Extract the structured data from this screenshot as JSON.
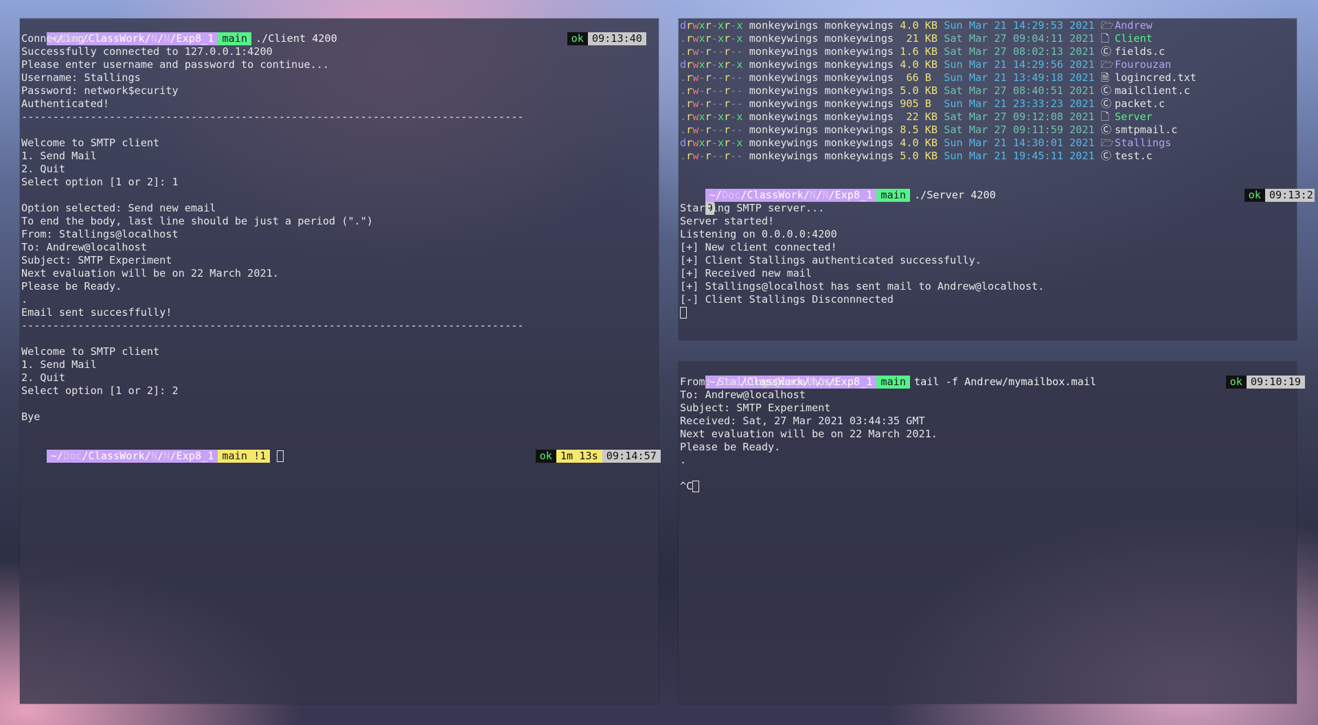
{
  "left_terminal": {
    "prompt1": {
      "path_home": "~/",
      "path_dim1": "Doc",
      "path_mid": "/ClassWork/",
      "path_dim2": "N",
      "path_sep": "/",
      "path_dim3": "N",
      "path_tail": "/Exp8_1",
      "branch": "main",
      "command": "./Client 4200",
      "status": "ok",
      "time": "09:13:40"
    },
    "output": [
      "Connecting...",
      "Successfully connected to 127.0.0.1:4200",
      "Please enter username and password to continue...",
      "Username: Stallings",
      "Password: network$ecurity",
      "Authenticated!",
      "--------------------------------------------------------------------------------",
      "",
      "Welcome to SMTP client",
      "1. Send Mail",
      "2. Quit",
      "Select option [1 or 2]: 1",
      "",
      "Option selected: Send new email",
      "To end the body, last line should be just a period (\".\")",
      "From: Stallings@localhost",
      "To: Andrew@localhost",
      "Subject: SMTP Experiment",
      "Next evaluation will be on 22 March 2021.",
      "Please be Ready.",
      ".",
      "Email sent succesffully!",
      "--------------------------------------------------------------------------------",
      "",
      "Welcome to SMTP client",
      "1. Send Mail",
      "2. Quit",
      "Select option [1 or 2]: 2",
      "",
      "Bye"
    ],
    "prompt2": {
      "path_home": "~/",
      "path_dim1": "Doc",
      "path_mid": "/ClassWork/",
      "path_dim2": "N",
      "path_sep": "/",
      "path_dim3": "N",
      "path_tail": "/Exp8_1",
      "branch": "main !1",
      "status": "ok",
      "duration": "1m 13s",
      "time": "09:14:57"
    }
  },
  "ls_listing": [
    {
      "type": "d",
      "perm": [
        "d",
        "r",
        "w",
        "x",
        "r",
        "-",
        "x",
        "r",
        "-",
        "x"
      ],
      "owner": "monkeywings",
      "group": "monkeywings",
      "size": "4.0 KB",
      "date": "Sun Mar 21 14:29:53 2021",
      "icon": "folder-icon",
      "name": "Andrew",
      "kind": "dir"
    },
    {
      "type": ".",
      "perm": [
        ".",
        "r",
        "w",
        "x",
        "r",
        "-",
        "x",
        "r",
        "-",
        "x"
      ],
      "owner": "monkeywings",
      "group": "monkeywings",
      "size": " 21 KB",
      "date": "Sat Mar 27 09:04:11 2021",
      "icon": "file-icon",
      "name": "Client",
      "kind": "exe"
    },
    {
      "type": ".",
      "perm": [
        ".",
        "r",
        "w",
        "-",
        "r",
        "-",
        "-",
        "r",
        "-",
        "-"
      ],
      "owner": "monkeywings",
      "group": "monkeywings",
      "size": "1.6 KB",
      "date": "Sat Mar 27 08:02:13 2021",
      "icon": "c-icon",
      "name": "fields.c",
      "kind": "c"
    },
    {
      "type": "d",
      "perm": [
        "d",
        "r",
        "w",
        "x",
        "r",
        "-",
        "x",
        "r",
        "-",
        "x"
      ],
      "owner": "monkeywings",
      "group": "monkeywings",
      "size": "4.0 KB",
      "date": "Sun Mar 21 14:29:56 2021",
      "icon": "folder-icon",
      "name": "Fourouzan",
      "kind": "dir"
    },
    {
      "type": ".",
      "perm": [
        ".",
        "r",
        "w",
        "-",
        "r",
        "-",
        "-",
        "r",
        "-",
        "-"
      ],
      "owner": "monkeywings",
      "group": "monkeywings",
      "size": " 66 B ",
      "date": "Sun Mar 21 13:49:18 2021",
      "icon": "doc-icon",
      "name": "logincred.txt",
      "kind": "c"
    },
    {
      "type": ".",
      "perm": [
        ".",
        "r",
        "w",
        "-",
        "r",
        "-",
        "-",
        "r",
        "-",
        "-"
      ],
      "owner": "monkeywings",
      "group": "monkeywings",
      "size": "5.0 KB",
      "date": "Sat Mar 27 08:40:51 2021",
      "icon": "c-icon",
      "name": "mailclient.c",
      "kind": "c"
    },
    {
      "type": ".",
      "perm": [
        ".",
        "r",
        "w",
        "-",
        "r",
        "-",
        "-",
        "r",
        "-",
        "-"
      ],
      "owner": "monkeywings",
      "group": "monkeywings",
      "size": "905 B ",
      "date": "Sun Mar 21 23:33:23 2021",
      "icon": "c-icon",
      "name": "packet.c",
      "kind": "c"
    },
    {
      "type": ".",
      "perm": [
        ".",
        "r",
        "w",
        "x",
        "r",
        "-",
        "x",
        "r",
        "-",
        "x"
      ],
      "owner": "monkeywings",
      "group": "monkeywings",
      "size": " 22 KB",
      "date": "Sat Mar 27 09:12:08 2021",
      "icon": "file-icon",
      "name": "Server",
      "kind": "exe"
    },
    {
      "type": ".",
      "perm": [
        ".",
        "r",
        "w",
        "-",
        "r",
        "-",
        "-",
        "r",
        "-",
        "-"
      ],
      "owner": "monkeywings",
      "group": "monkeywings",
      "size": "8.5 KB",
      "date": "Sat Mar 27 09:11:59 2021",
      "icon": "c-icon",
      "name": "smtpmail.c",
      "kind": "c"
    },
    {
      "type": "d",
      "perm": [
        "d",
        "r",
        "w",
        "x",
        "r",
        "-",
        "x",
        "r",
        "-",
        "x"
      ],
      "owner": "monkeywings",
      "group": "monkeywings",
      "size": "4.0 KB",
      "date": "Sun Mar 21 14:30:01 2021",
      "icon": "folder-icon",
      "name": "Stallings",
      "kind": "dir"
    },
    {
      "type": ".",
      "perm": [
        ".",
        "r",
        "w",
        "-",
        "r",
        "-",
        "-",
        "r",
        "-",
        "-"
      ],
      "owner": "monkeywings",
      "group": "monkeywings",
      "size": "5.0 KB",
      "date": "Sun Mar 21 19:45:11 2021",
      "icon": "c-icon",
      "name": "test.c",
      "kind": "c"
    }
  ],
  "server_terminal": {
    "prompt": {
      "path_home": "~/",
      "path_dim1": "Doc",
      "path_mid": "/ClassWork/",
      "path_dim2": "N",
      "path_sep": "/",
      "path_dim3": "N",
      "path_tail": "/Exp8_1",
      "branch": "main",
      "command": "./Server 4200",
      "status": "ok",
      "time": "09:13:2",
      "time_wrap": "9"
    },
    "output": [
      "Starting SMTP server...",
      "Server started!",
      "Listening on 0.0.0.0:4200",
      "[+] New client connected!",
      "[+] Client Stallings authenticated successfully.",
      "[+] Received new mail",
      "[+] Stallings@localhost has sent mail to Andrew@localhost.",
      "[-] Client Stallings Disconnnected"
    ]
  },
  "tail_terminal": {
    "prompt": {
      "path_home": "~/",
      "path_dim1": "Doc",
      "path_mid": "/ClassWork/",
      "path_dim2": "N",
      "path_sep": "/",
      "path_dim3": "N",
      "path_tail": "/Exp8_1",
      "branch": "main",
      "command": "tail -f Andrew/mymailbox.mail",
      "status": "ok",
      "time": "09:10:19"
    },
    "output": [
      "From: Stallings@localhost",
      "To: Andrew@localhost",
      "Subject: SMTP Experiment",
      "Received: Sat, 27 Mar 2021 03:44:35 GMT",
      "Next evaluation will be on 22 March 2021.",
      "Please be Ready.",
      ".",
      ""
    ],
    "interrupt": "^C"
  }
}
